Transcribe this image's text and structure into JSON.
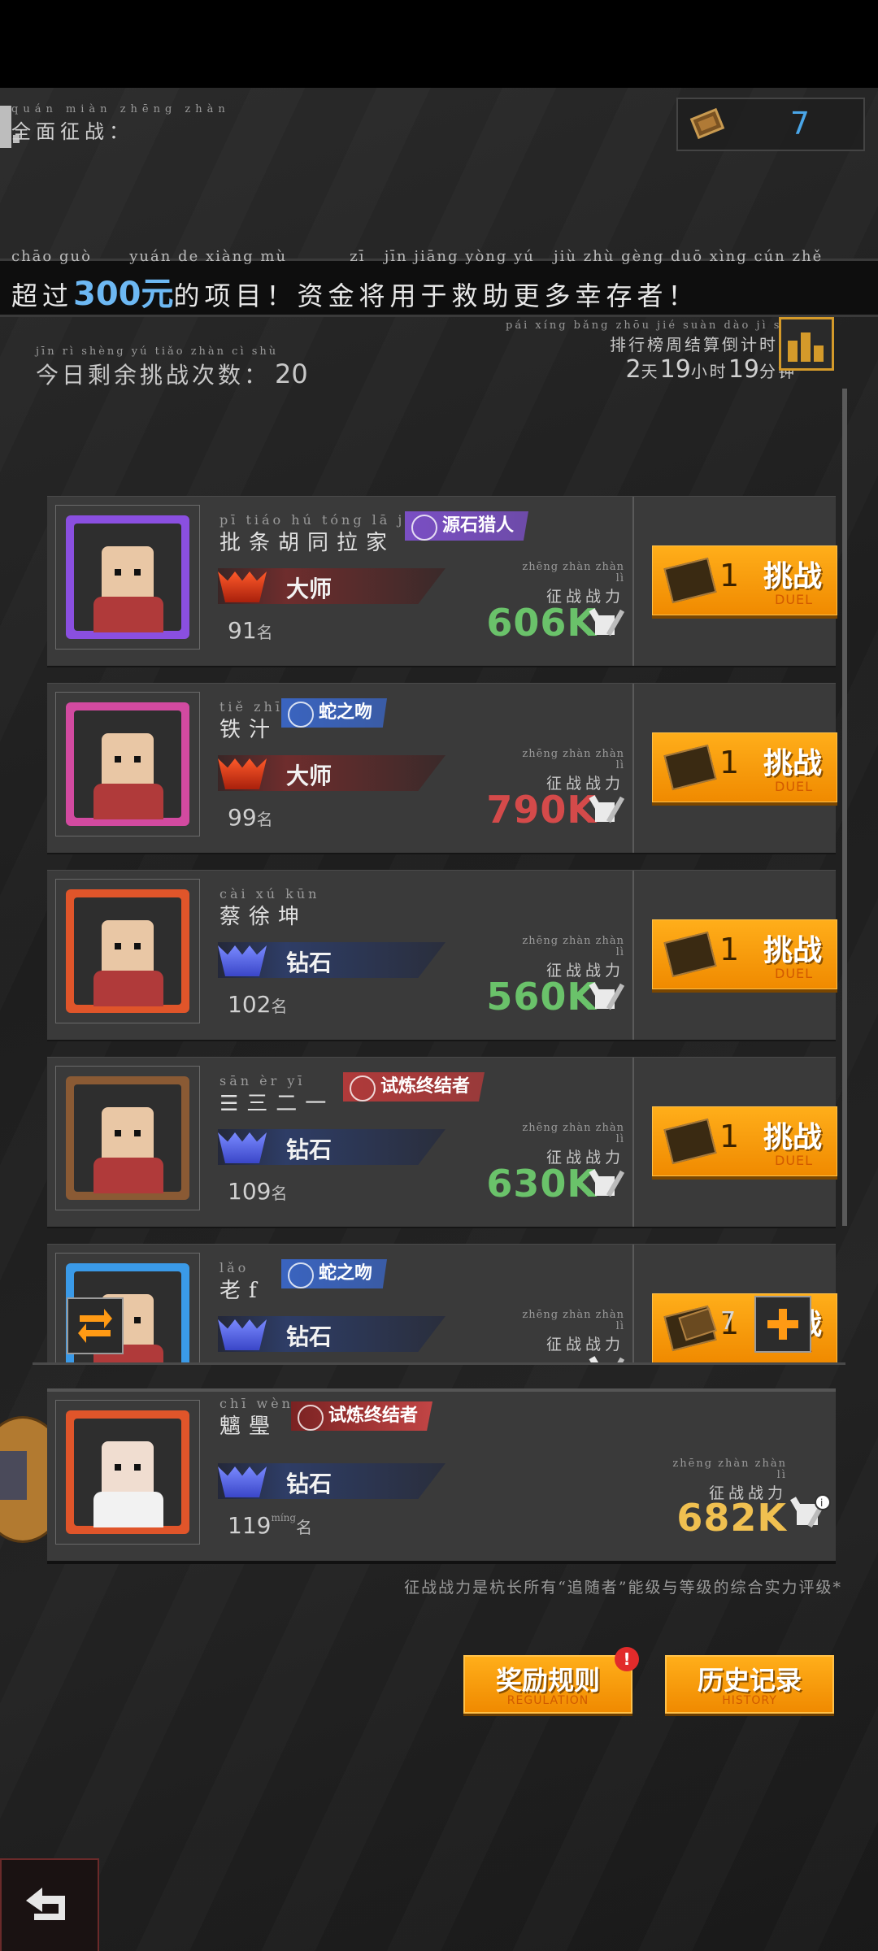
{
  "header": {
    "mode_pinyin": "quán miàn zhēng zhàn",
    "mode_title": "全面征战：",
    "tickets": "7"
  },
  "banner": {
    "pinyin": "chāo guò      yuán de xiàng mù          zī   jīn jiāng yòng yú   jiù zhù gèng duō xìng cún zhě",
    "pre": "超过",
    "amount": "300",
    "unit": "元",
    "post": "的项目！资金将用于救助更多幸存者！"
  },
  "challenge": {
    "remain_pinyin": "jīn rì shèng yú tiǎo zhàn cì shù",
    "remain_label": "今日剩余挑战次数：",
    "remain_value": "20",
    "countdown_pinyin": "pái xíng bǎng zhōu jié suàn dào  jì  shí",
    "countdown_label": "排行榜周结算倒计时：",
    "days": "2",
    "day_unit": "天",
    "hours": "19",
    "hour_unit": "小时",
    "minutes": "19",
    "minute_unit": "分钟"
  },
  "power_label": "征战战力",
  "power_pinyin": "zhēng zhàn zhàn  lì",
  "place_unit": "名",
  "place_pinyin": "míng",
  "duel": {
    "label": "挑战",
    "sub": "DUEL",
    "cost": "1"
  },
  "opponents": [
    {
      "name": "批条胡同拉家",
      "tag": "源石猎人",
      "tag_color": "#7a4fc4",
      "rank": "大师",
      "place": "91",
      "power": "606K",
      "power_color": "#6ac26a",
      "frame": "#8a4fe0"
    },
    {
      "name": "铁汁",
      "tag": "蛇之吻",
      "tag_color": "#3a64c0",
      "rank": "大师",
      "place": "99",
      "power": "790K",
      "power_color": "#d44a4a",
      "frame": "#d24aa0"
    },
    {
      "name": "蔡徐坤",
      "tag": "",
      "tag_color": "",
      "rank": "钻石",
      "place": "102",
      "power": "560K",
      "power_color": "#6ac26a",
      "frame": "#e0552a"
    },
    {
      "name": "☰三二一",
      "tag": "试炼终结者",
      "tag_color": "#b03a3a",
      "rank": "钻石",
      "place": "109",
      "power": "630K",
      "power_color": "#6ac26a",
      "frame": "#8a5a34"
    },
    {
      "name": "老f",
      "tag": "蛇之吻",
      "tag_color": "#3a64c0",
      "rank": "钻石",
      "place": "",
      "power": "",
      "power_color": "#d44a4a",
      "frame": "#3a9ae8"
    }
  ],
  "bottom_bar": {
    "tickets": "7"
  },
  "self": {
    "name": "魑璺",
    "tag": "试炼终结者",
    "rank": "钻石",
    "place": "119",
    "power": "682K"
  },
  "note": "征战战力是杭长所有“追随者”能级与等级的综合实力评级*",
  "buttons": {
    "rules": "奖励规则",
    "rules_sub": "REGULATION",
    "history": "历史记录",
    "history_sub": "HISTORY",
    "badge": "!"
  },
  "colors": {
    "accent": "#ff9a14",
    "blue_text": "#4aa6e8",
    "green": "#6ac26a",
    "red": "#d44a4a",
    "gold": "#f0c050"
  }
}
